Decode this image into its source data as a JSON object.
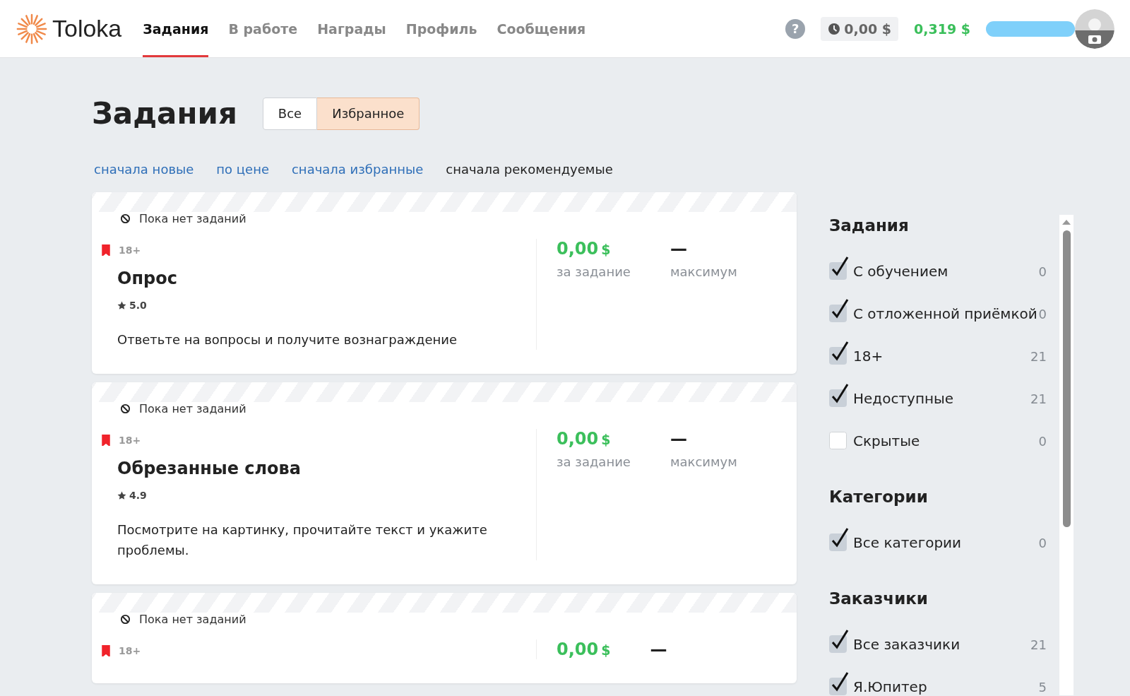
{
  "header": {
    "logo": "Toloka",
    "nav": [
      {
        "label": "Задания",
        "selected": true
      },
      {
        "label": "В работе",
        "selected": false
      },
      {
        "label": "Награды",
        "selected": false
      },
      {
        "label": "Профиль",
        "selected": false
      },
      {
        "label": "Сообщения",
        "selected": false
      }
    ],
    "help": "?",
    "pending": "0,00 $",
    "balance": "0,319 $"
  },
  "page": {
    "title": "Задания",
    "toggle": [
      {
        "label": "Все",
        "selected": false
      },
      {
        "label": "Избранное",
        "selected": true
      }
    ],
    "sort": [
      {
        "label": "сначала новые",
        "selected": false
      },
      {
        "label": "по цене",
        "selected": false
      },
      {
        "label": "сначала избранные",
        "selected": false
      },
      {
        "label": "сначала рекомендуемые",
        "selected": true
      }
    ]
  },
  "cards": [
    {
      "status": "Пока нет заданий",
      "favorite": true,
      "age": "18+",
      "title": "Опрос",
      "rating": "5.0",
      "description": "Ответьте на вопросы и получите вознаграждение",
      "price": "0,00",
      "currency": "$",
      "price_label": "за задание",
      "max": "—",
      "max_label": "максимум"
    },
    {
      "status": "Пока нет заданий",
      "favorite": true,
      "age": "18+",
      "title": "Обрезанные слова",
      "rating": "4.9",
      "description": "Посмотрите на картинку, прочитайте текст и укажите проблемы.",
      "price": "0,00",
      "currency": "$",
      "price_label": "за задание",
      "max": "—",
      "max_label": "максимум"
    },
    {
      "status": "Пока нет заданий",
      "favorite": true,
      "age": "18+",
      "price": "0,00",
      "currency": "$",
      "max": "—"
    }
  ],
  "filters": [
    {
      "title": "Задания",
      "items": [
        {
          "label": "С обучением",
          "checked": true,
          "count": "0"
        },
        {
          "label": "С отложенной приёмкой",
          "checked": true,
          "count": "0"
        },
        {
          "label": "18+",
          "checked": true,
          "count": "21"
        },
        {
          "label": "Недоступные",
          "checked": true,
          "count": "21"
        },
        {
          "label": "Скрытые",
          "checked": false,
          "count": "0"
        }
      ]
    },
    {
      "title": "Категории",
      "items": [
        {
          "label": "Все категории",
          "checked": true,
          "count": "0"
        }
      ]
    },
    {
      "title": "Заказчики",
      "items": [
        {
          "label": "Все заказчики",
          "checked": true,
          "count": "21"
        },
        {
          "label": "Я.Юпитер",
          "checked": true,
          "count": "5"
        }
      ]
    }
  ]
}
